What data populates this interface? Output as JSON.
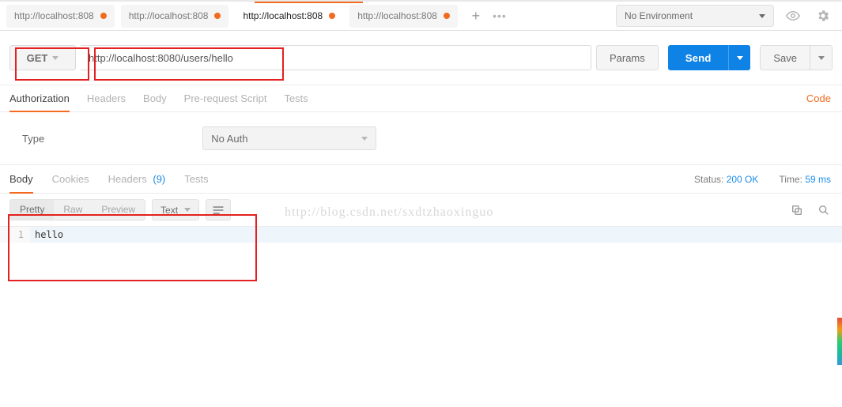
{
  "header": {
    "tabs": [
      {
        "label": "http://localhost:808",
        "dirty": true,
        "active": false
      },
      {
        "label": "http://localhost:808",
        "dirty": true,
        "active": false
      },
      {
        "label": "http://localhost:808",
        "dirty": true,
        "active": true
      },
      {
        "label": "http://localhost:808",
        "dirty": true,
        "active": false
      }
    ],
    "environment": {
      "selected": "No Environment"
    }
  },
  "request": {
    "method": "GET",
    "url": "http://localhost:8080/users/hello",
    "params_label": "Params",
    "send_label": "Send",
    "save_label": "Save"
  },
  "request_tabs": {
    "items": [
      {
        "label": "Authorization",
        "active": true
      },
      {
        "label": "Headers",
        "active": false
      },
      {
        "label": "Body",
        "active": false
      },
      {
        "label": "Pre-request Script",
        "active": false
      },
      {
        "label": "Tests",
        "active": false
      }
    ],
    "code_link": "Code"
  },
  "auth": {
    "type_label": "Type",
    "selected": "No Auth"
  },
  "response_tabs": {
    "items": [
      {
        "label": "Body",
        "count": null,
        "active": true
      },
      {
        "label": "Cookies",
        "count": null,
        "active": false
      },
      {
        "label": "Headers",
        "count": "(9)",
        "active": false
      },
      {
        "label": "Tests",
        "count": null,
        "active": false
      }
    ],
    "status": {
      "label": "Status:",
      "value": "200 OK"
    },
    "time": {
      "label": "Time:",
      "value": "59 ms"
    }
  },
  "viewer": {
    "modes": [
      {
        "label": "Pretty",
        "active": true
      },
      {
        "label": "Raw",
        "active": false
      },
      {
        "label": "Preview",
        "active": false
      }
    ],
    "format": "Text"
  },
  "response_body": {
    "line_number": "1",
    "content": "hello"
  },
  "watermark": "http://blog.csdn.net/sxdtzhaoxinguo"
}
